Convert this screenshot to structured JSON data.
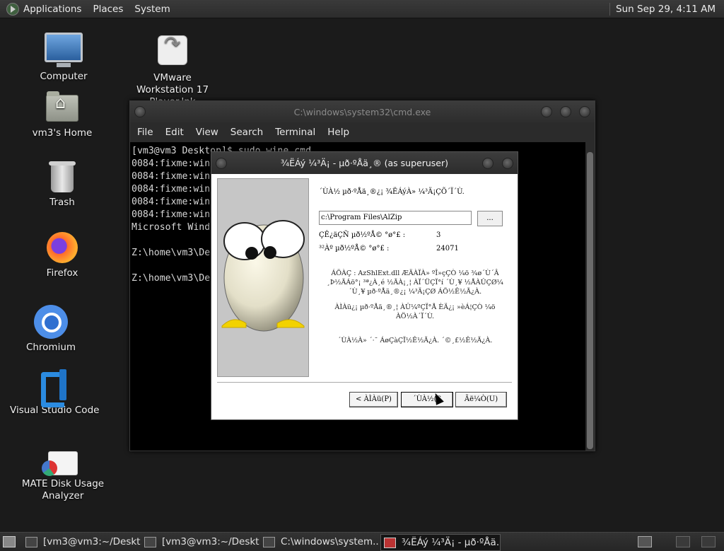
{
  "top_panel": {
    "menus": [
      "Applications",
      "Places",
      "System"
    ],
    "clock": "Sun Sep 29,  4:11 AM"
  },
  "desktop_icons": [
    {
      "name": "computer",
      "icon": "monitor-icon",
      "label": "Computer"
    },
    {
      "name": "vmware",
      "icon": "shortcut-link-icon",
      "label": "VMware Workstation 17 Player.lnk"
    },
    {
      "name": "home",
      "icon": "home-folder-icon",
      "label": "vm3's Home"
    },
    {
      "name": "trash",
      "icon": "trash-icon",
      "label": "Trash"
    },
    {
      "name": "firefox",
      "icon": "firefox-icon",
      "label": "Firefox"
    },
    {
      "name": "chromium",
      "icon": "chromium-icon",
      "label": "Chromium"
    },
    {
      "name": "vscode",
      "icon": "vscode-icon",
      "label": "Visual Studio Code"
    },
    {
      "name": "disk-usage",
      "icon": "disk-usage-icon",
      "label": "MATE Disk Usage Analyzer"
    }
  ],
  "terminal": {
    "title": "C:\\windows\\system32\\cmd.exe",
    "menus": [
      "File",
      "Edit",
      "View",
      "Search",
      "Terminal",
      "Help"
    ],
    "lines": [
      "[vm3@vm3 Desktop]$ sudo wine cmd",
      "0084:fixme:win",
      "0084:fixme:win",
      "0084:fixme:win",
      "0084:fixme:win",
      "0084:fixme:win",
      "Microsoft Wind",
      "",
      "Z:\\home\\vm3\\De",
      "",
      "Z:\\home\\vm3\\De"
    ]
  },
  "dialog": {
    "title": "¾ËÁý ¼³Ä¡ - µð·ºÅä¸® (as superuser)",
    "intro": "´ÙÀ½ µð·ºÅä¸®¿¡ ¾ËÁýÀ» ¼³Ä¡ÇÕ´Ï´Ù.",
    "install_path": "c:\\Program Files\\AlZip",
    "browse_label": "...",
    "required_label": "ÇÊ¿äÇÑ µð½ºÅ© °ø°£ :",
    "required_value": "3",
    "available_label": "³²Àº µð½ºÅ© °ø°£ :",
    "available_value": "24071",
    "notice1_lines": [
      "ÁÖÀÇ : AzShlExt.dll ÆÄÀÏÀ» ºÎ»çÇÒ ¼ö ¾ø´Ù´Â",
      "¸Þ½ÃÁö°¡ ³ª¿À¸é ½ÃÀ¡¸¦ ÀÏ´ÜÇÏ°í ´Ù¸¥ ½ÅÀÛÇØ¼­",
      "´Ù¸¥ µð·ºÅä¸®¿¡ ¼³Ä¡ÇØ ÁÖ½Ê½Ã¿À."
    ],
    "notice2_lines": [
      "ÀÌÀü¿¡ µð·ºÅä¸®¸¦ ÀÛ¼ºÇÏ°Å ÈÄ¿¡ »èÁ¦ÇÒ ¼ö",
      "ÀÖ½À´Ï´Ù."
    ],
    "notice3": "´ÙÀ½À» ´­·¯ ÁøÇàÇÏ½Ê½Ã¿À. ´©¸£½Ê½Ã¿À.",
    "buttons": {
      "back": "< ÀÌÀü(P)",
      "next": "´ÙÀ½(S",
      "cancel": "Ãë¼Ò(U)"
    }
  },
  "taskbar": {
    "tasks": [
      {
        "label": "[vm3@vm3:~/Deskt...",
        "active": false
      },
      {
        "label": "[vm3@vm3:~/Deskt...",
        "active": false
      },
      {
        "label": "C:\\windows\\system...",
        "active": false
      },
      {
        "label": "¾ËÁý ¼³Ä¡ - µð·ºÅä...",
        "active": true
      }
    ]
  }
}
